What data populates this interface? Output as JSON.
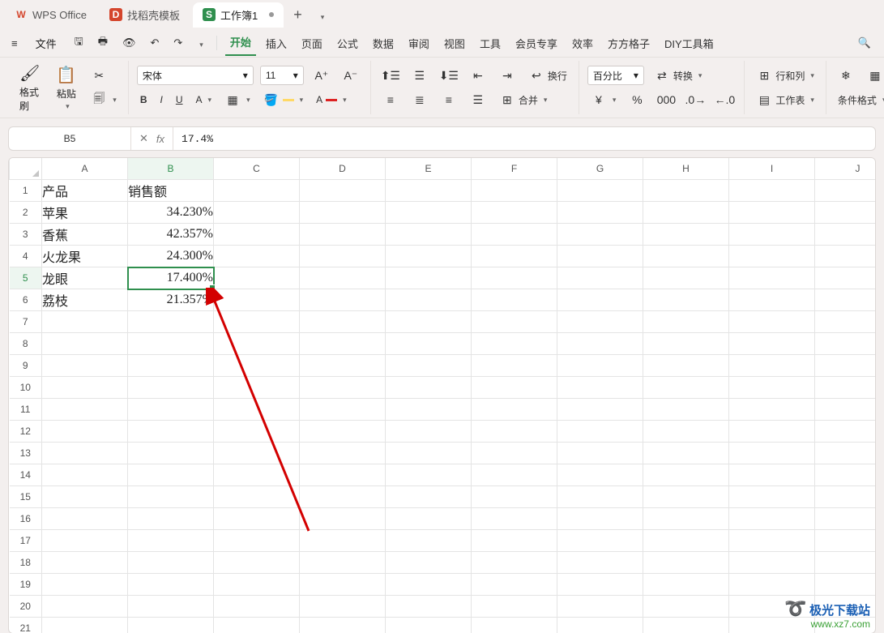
{
  "titlebar": {
    "tabs": [
      {
        "label": "WPS Office",
        "icon_text": "W",
        "icon_color": "#d4452c"
      },
      {
        "label": "找稻壳模板",
        "icon_text": "D",
        "icon_color": "#d4452c"
      },
      {
        "label": "工作簿1",
        "icon_text": "S",
        "icon_color": "#2f8f4e"
      }
    ],
    "add_label": "+"
  },
  "menubar": {
    "hamburger": "≡",
    "file": "文件",
    "items": [
      "开始",
      "插入",
      "页面",
      "公式",
      "数据",
      "审阅",
      "视图",
      "工具",
      "会员专享",
      "效率",
      "方方格子",
      "DIY工具箱"
    ],
    "active_index": 0
  },
  "ribbon": {
    "format_painter": "格式刷",
    "paste": "粘贴",
    "font_name": "宋体",
    "font_size": "11",
    "wrap": "换行",
    "merge": "合并",
    "percent_label": "百分比",
    "convert": "转换",
    "rowcol": "行和列",
    "worksheet": "工作表",
    "cond_format": "条件格式"
  },
  "formula_bar": {
    "name_box": "B5",
    "fx": "fx",
    "content": "17.4%"
  },
  "grid": {
    "columns": [
      "A",
      "B",
      "C",
      "D",
      "E",
      "F",
      "G",
      "H",
      "I",
      "J"
    ],
    "active_col_index": 1,
    "active_row_index": 4,
    "rows": 21,
    "cells": {
      "header_a": "产品",
      "header_b": "销售额",
      "data": [
        {
          "a": "苹果",
          "b": "34.230%"
        },
        {
          "a": "香蕉",
          "b": "42.357%"
        },
        {
          "a": "火龙果",
          "b": "24.300%"
        },
        {
          "a": "龙眼",
          "b": "17.400%"
        },
        {
          "a": "荔枝",
          "b": "21.357%"
        }
      ]
    }
  },
  "watermark": {
    "cn": "极光下载站",
    "en": "www.xz7.com"
  },
  "icons": {
    "semantic_names": [
      "wps-logo-icon",
      "docker-template-icon",
      "spreadsheet-icon",
      "add-tab-icon",
      "dropdown-icon",
      "hamburger-icon",
      "save-icon",
      "print-icon",
      "print-preview-icon",
      "undo-icon",
      "redo-icon",
      "format-painter-icon",
      "paste-icon",
      "cut-icon",
      "copy-format-icon",
      "bold-icon",
      "italic-icon",
      "underline-icon",
      "font-color-icon",
      "border-icon",
      "fill-color-icon",
      "text-color-icon",
      "increase-font-icon",
      "decrease-font-icon",
      "align-top-icon",
      "align-middle-icon",
      "align-bottom-icon",
      "align-left-icon",
      "align-center-icon",
      "align-right-icon",
      "indent-decrease-icon",
      "indent-increase-icon",
      "wrap-text-icon",
      "merge-icon",
      "currency-icon",
      "percent-icon",
      "comma-icon",
      "increase-decimal-icon",
      "decrease-decimal-icon",
      "convert-icon",
      "rows-cols-icon",
      "worksheet-icon",
      "freeze-icon",
      "conditional-format-icon",
      "sum-icon",
      "cancel-icon",
      "fx-icon",
      "search-icon",
      "chevron-down-icon"
    ]
  }
}
